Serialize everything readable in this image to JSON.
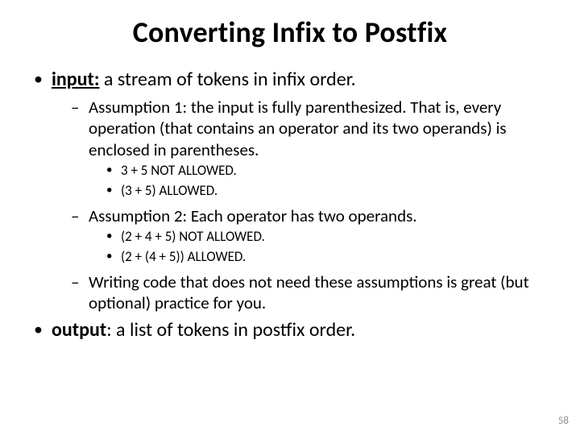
{
  "title": "Converting Infix to Postfix",
  "b1": {
    "label": "input:",
    "rest": " a stream of tokens in infix order.",
    "a1": "Assumption 1: the input is fully parenthesized. That is, every operation (that contains an operator and its two operands) is enclosed in parentheses.",
    "a1_ex1": "3 + 5   NOT ALLOWED.",
    "a1_ex2": "(3 + 5)   ALLOWED.",
    "a2": "Assumption 2: Each operator has two operands.",
    "a2_ex1": "(2 + 4 + 5)   NOT ALLOWED.",
    "a2_ex2": "(2 + (4 + 5))   ALLOWED.",
    "a3": "Writing code that does not need these assumptions is great (but optional) practice for you."
  },
  "b2": {
    "label": "output",
    "rest": ": a list of tokens in postfix order."
  },
  "page": "58"
}
